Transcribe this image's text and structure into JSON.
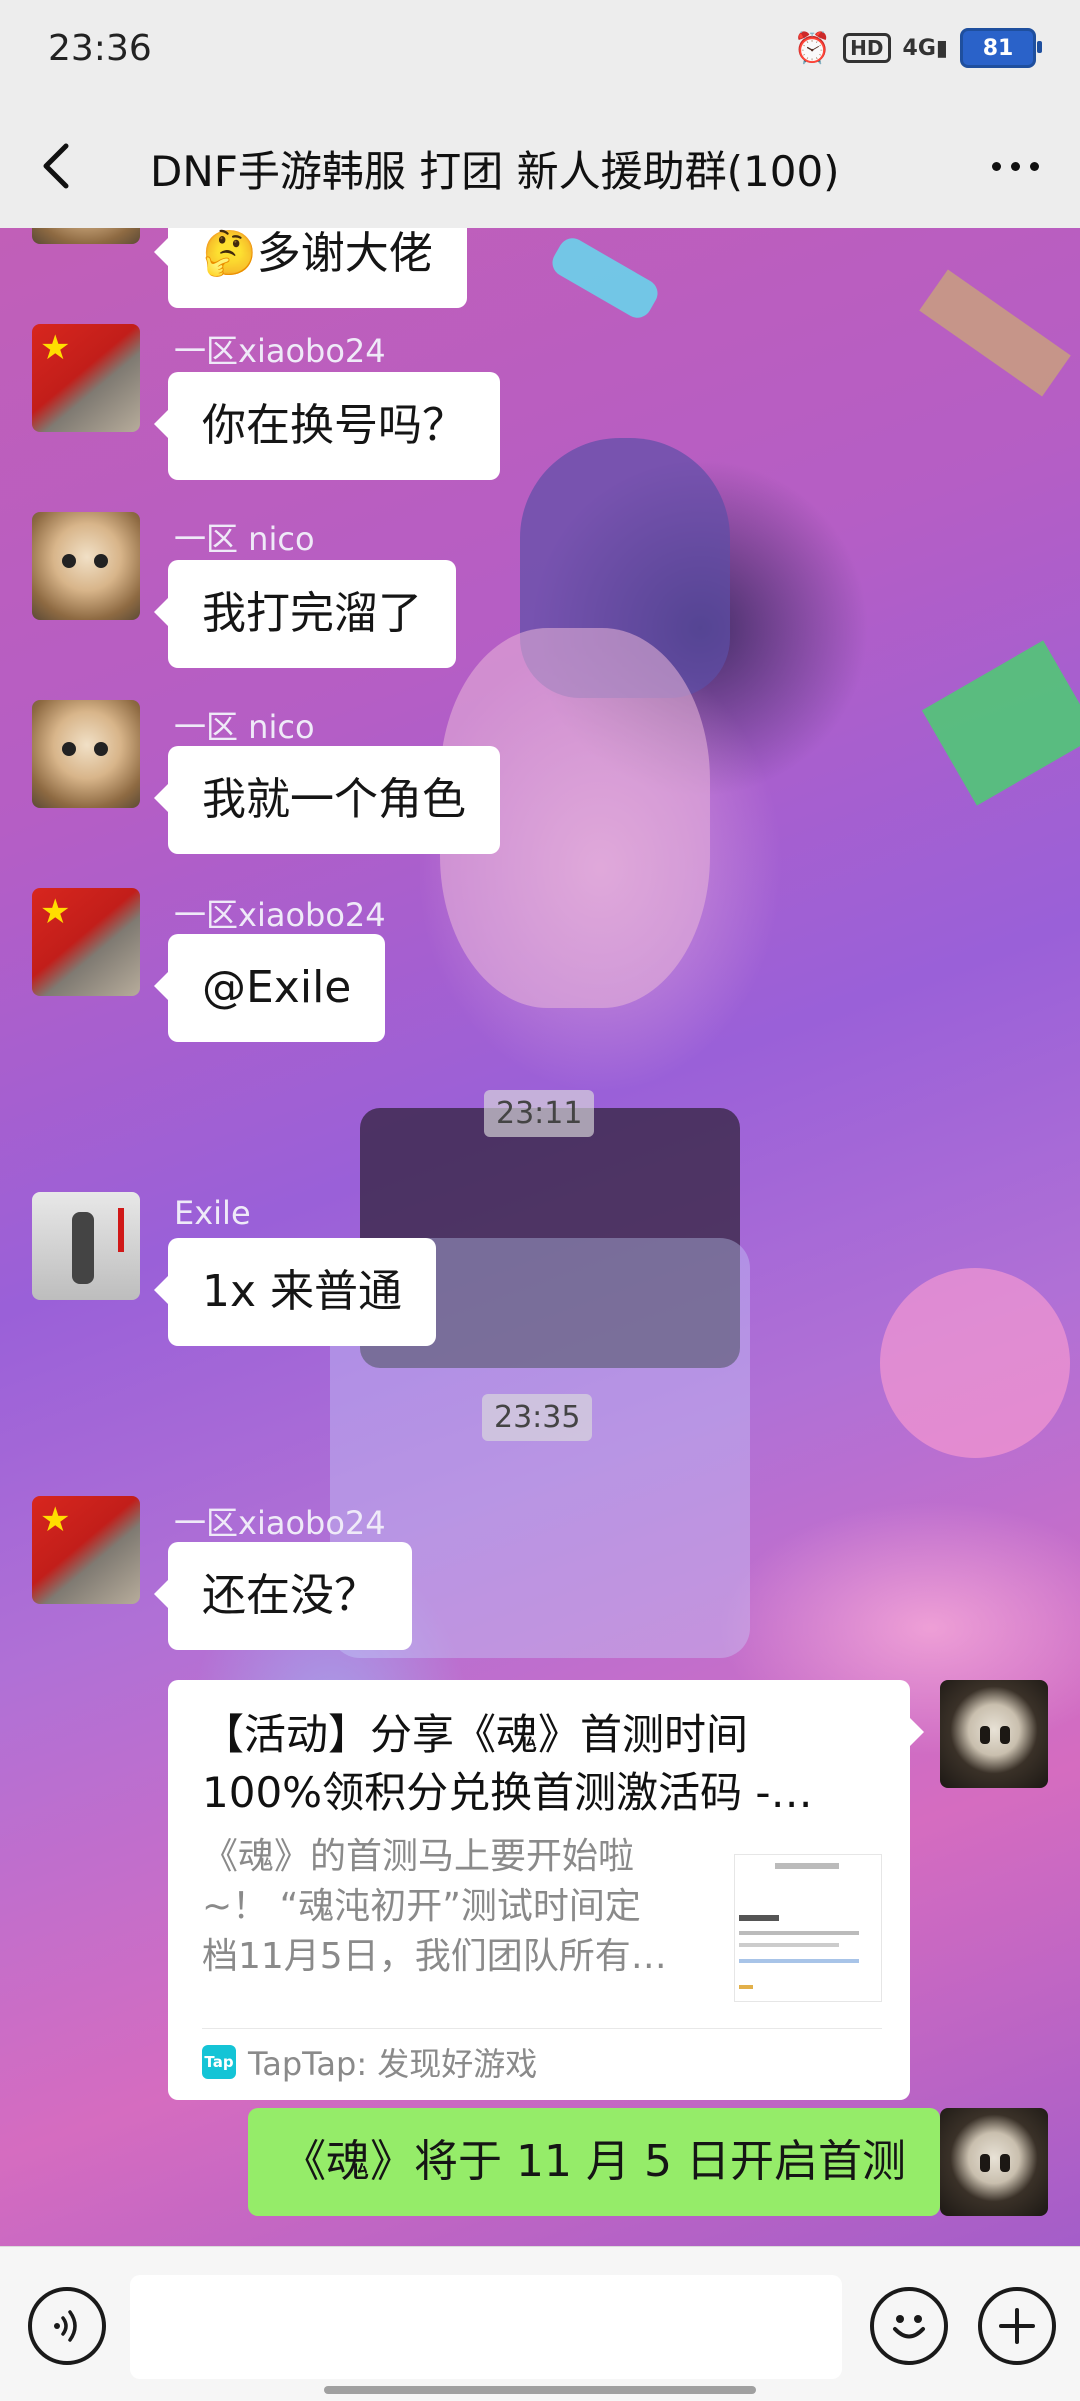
{
  "status_bar": {
    "time": "23:36",
    "alarm_icon": "alarm-icon",
    "hd_label": "HD",
    "signal_label": "4G",
    "battery_level": "81"
  },
  "header": {
    "back_icon": "back-arrow-icon",
    "title": "DNF手游韩服 打团 新人援助群(100)",
    "more_icon": "more-dots-icon"
  },
  "messages": [
    {
      "sender": "",
      "text": "🤔多谢大佬"
    },
    {
      "sender": "一区xiaobo24",
      "text": "你在换号吗？"
    },
    {
      "sender": "一区  nico",
      "text": "我打完溜了"
    },
    {
      "sender": "一区  nico",
      "text": "我就一个角色"
    },
    {
      "sender": "一区xiaobo24",
      "text": "@Exile"
    },
    {
      "sender": "Exile",
      "text": "1x 来普通"
    },
    {
      "sender": "一区xiaobo24",
      "text": "还在没？"
    }
  ],
  "timestamps": [
    "23:11",
    "23:35"
  ],
  "share_card": {
    "title_line1": "【活动】分享《魂》首测时间",
    "title_line2": "100%领积分兑换首测激活码 -…",
    "description": "《魂》的首测马上要开始啦~！ “魂沌初开”测试时间定档11月5日，我们团队所有…",
    "source_logo": "Tap",
    "source": "TapTap: 发现好游戏"
  },
  "my_message": {
    "text": "《魂》将于 11 月 5 日开启首测"
  },
  "input_bar": {
    "voice_icon": "voice-icon",
    "emoji_icon": "emoji-icon",
    "add_icon": "add-icon",
    "placeholder": ""
  },
  "colors": {
    "my_bubble": "#95ec69",
    "other_bubble": "#ffffff",
    "nav_bg": "#ededed"
  }
}
